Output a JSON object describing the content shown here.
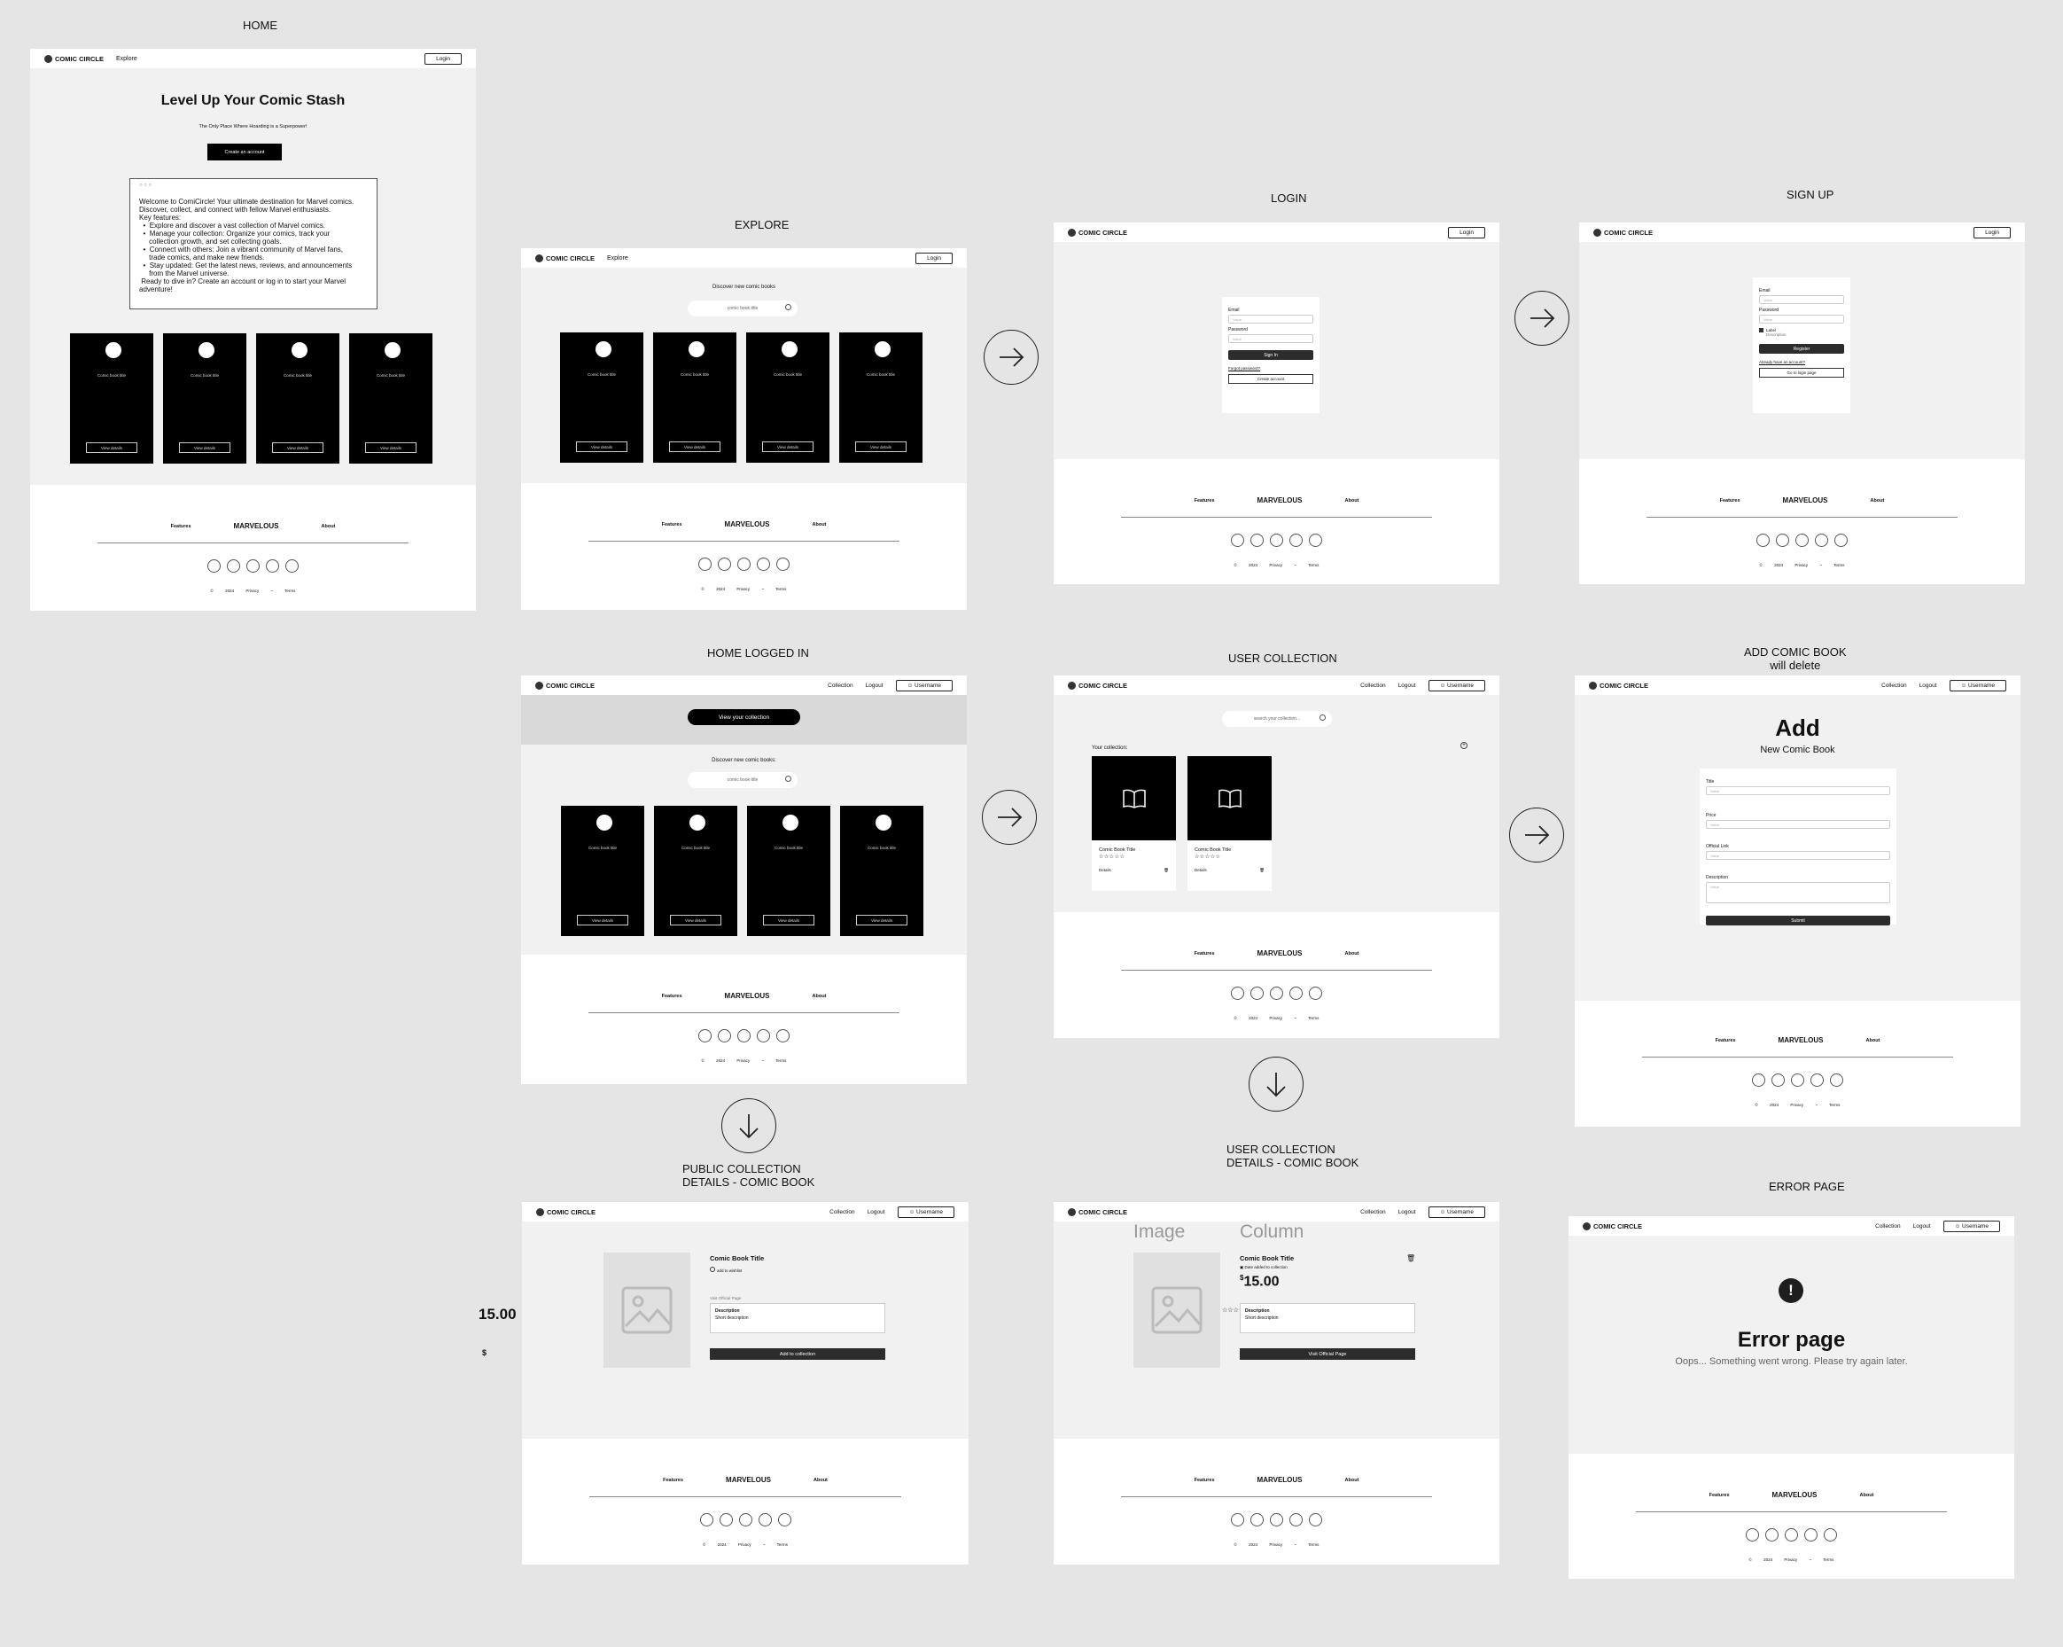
{
  "screens": {
    "home": "HOME",
    "explore": "EXPLORE",
    "login": "LOGIN",
    "signup": "SIGN UP",
    "home_logged": "HOME LOGGED IN",
    "user_collection": "USER COLLECTION",
    "add_comic_1": "ADD COMIC BOOK",
    "add_comic_2": "will delete",
    "public_details_1": "PUBLIC COLLECTION",
    "public_details_2": "DETAILS - COMIC BOOK",
    "user_details_1": "USER COLLECTION",
    "user_details_2": "DETAILS - COMIC BOOK",
    "error": "ERROR PAGE"
  },
  "header": {
    "logo": "COMIC CIRCLE",
    "explore": "Explore",
    "login": "Login",
    "collection": "Collection",
    "logout": "Logout",
    "username": "Username"
  },
  "footer": {
    "features": "Features",
    "brand": "MARVELOUS",
    "about": "About",
    "copyright": "© 2024 Privacy ~ Terms"
  },
  "home": {
    "title": "Level Up Your Comic Stash",
    "subtitle": "The Only Place Where Hoarding is a Superpower!",
    "cta": "Create an account",
    "window_dots": "○ ○ ○",
    "welcome_lines": [
      "Welcome to ComiCircle!  Your ultimate destination for Marvel comics.",
      "Discover, collect, and connect with fellow Marvel enthusiasts.",
      "Key features:",
      "  •  Explore and discover a vast collection of Marvel comics.",
      "  •  Manage your collection: Organize your comics, track your",
      "     collection growth, and set collecting goals.",
      "  •  Connect with others: Join a vibrant community of Marvel fans,",
      "     trade comics, and make new friends.",
      "  •  Stay updated: Get the latest news, reviews, and announcements",
      "     from the Marvel universe.",
      " Ready to dive in? Create an account or log in to start your Marvel",
      "adventure!"
    ]
  },
  "card": {
    "title": "Comic book title",
    "button": "View details"
  },
  "explore": {
    "discover": "Discover new comic books",
    "search": "comic book title"
  },
  "login": {
    "email": "Email",
    "password": "Password",
    "value": "Value",
    "signin": "Sign In",
    "forgot": "Forgot password?",
    "create": "Create account"
  },
  "signup": {
    "checkbox_label": "Label",
    "checkbox_desc": "Description",
    "register": "Register",
    "already": "Already have an account?",
    "goto": "Go to login page"
  },
  "logged": {
    "view_collection": "View your collection",
    "discover": "Discover new comic books:"
  },
  "collection": {
    "search": "search your collection...",
    "your": "Your collection:",
    "item_title": "Comic Book Title",
    "stars": "☆☆☆☆☆",
    "details": "Details"
  },
  "add": {
    "title": "Add",
    "subtitle": "New Comic Book",
    "f_title": "Title",
    "f_price": "Price",
    "f_link": "Official Link",
    "f_desc": "Description",
    "submit": "Submit"
  },
  "details": {
    "title": "Comic Book Title",
    "add_wishlist": "add to wishlist",
    "visit_link": "Visit Official Page",
    "desc_label": "Description",
    "desc_text": "Short description",
    "add_button": "Add to collection",
    "side_price": "15.00",
    "side_dollar": "$",
    "image_col": "Image",
    "column_col": "Column",
    "added": "Date added to collection",
    "dollar": "$",
    "price": "15.00",
    "stars": "☆☆☆☆☆",
    "visit_button": "Visit Official Page"
  },
  "error": {
    "title": "Error page",
    "text": "Oops... Something went wrong. Please try again later."
  }
}
